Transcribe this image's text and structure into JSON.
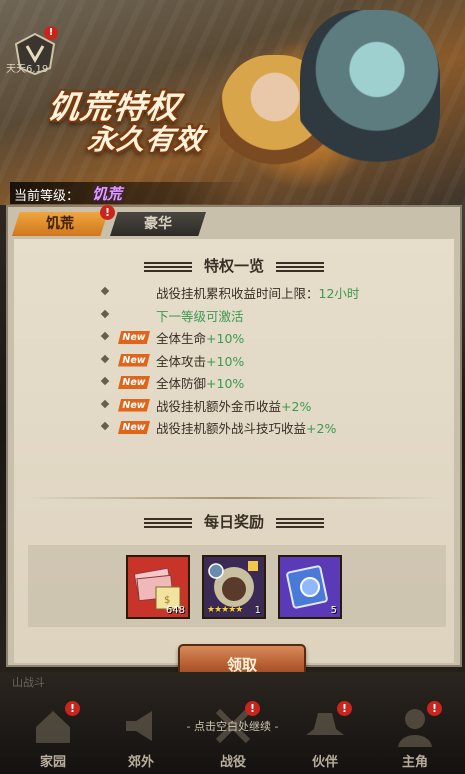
{
  "banner": {
    "slogan_line1": "饥荒特权",
    "slogan_line2": "永久有效",
    "top_label": "天天6.19",
    "top_badge": "!",
    "current_level_label": "当前等级：",
    "current_level_value": "饥荒"
  },
  "tabs": [
    {
      "label": "饥荒",
      "active": true,
      "badge": "!"
    },
    {
      "label": "豪华",
      "active": false
    }
  ],
  "privileges": {
    "title": "特权一览",
    "rows": [
      {
        "new": false,
        "text": "战役挂机累积收益时间上限：",
        "value": "12小时"
      },
      {
        "new": false,
        "text": "",
        "value": "下一等级可激活"
      },
      {
        "new": true,
        "text": "全体生命",
        "value": "+10%"
      },
      {
        "new": true,
        "text": "全体攻击",
        "value": "+10%"
      },
      {
        "new": true,
        "text": "全体防御",
        "value": "+10%"
      },
      {
        "new": true,
        "text": "战役挂机额外金币收益",
        "value": "+2%"
      },
      {
        "new": true,
        "text": "战役挂机额外战斗技巧收益",
        "value": "+2%"
      }
    ],
    "new_tag": "New"
  },
  "daily": {
    "title": "每日奖励",
    "items": [
      {
        "icon": "cash-stack-icon",
        "count": "648"
      },
      {
        "icon": "hero-card-icon",
        "count": "1",
        "stars": "★★★★★"
      },
      {
        "icon": "skill-ticket-icon",
        "count": "5"
      }
    ],
    "claim_label": "领取"
  },
  "footer": {
    "hint": "- 点击空白处继续 -",
    "left_text": "山战斗",
    "nav": [
      {
        "label": "家园",
        "badge": "!"
      },
      {
        "label": "郊外",
        "badge": ""
      },
      {
        "label": "战役",
        "badge": "!"
      },
      {
        "label": "伙伴",
        "badge": "!"
      },
      {
        "label": "主角",
        "badge": "!"
      }
    ]
  },
  "colors": {
    "accent": "#e0641a",
    "green": "#3d9a50",
    "purple": "#d9a0ff"
  }
}
